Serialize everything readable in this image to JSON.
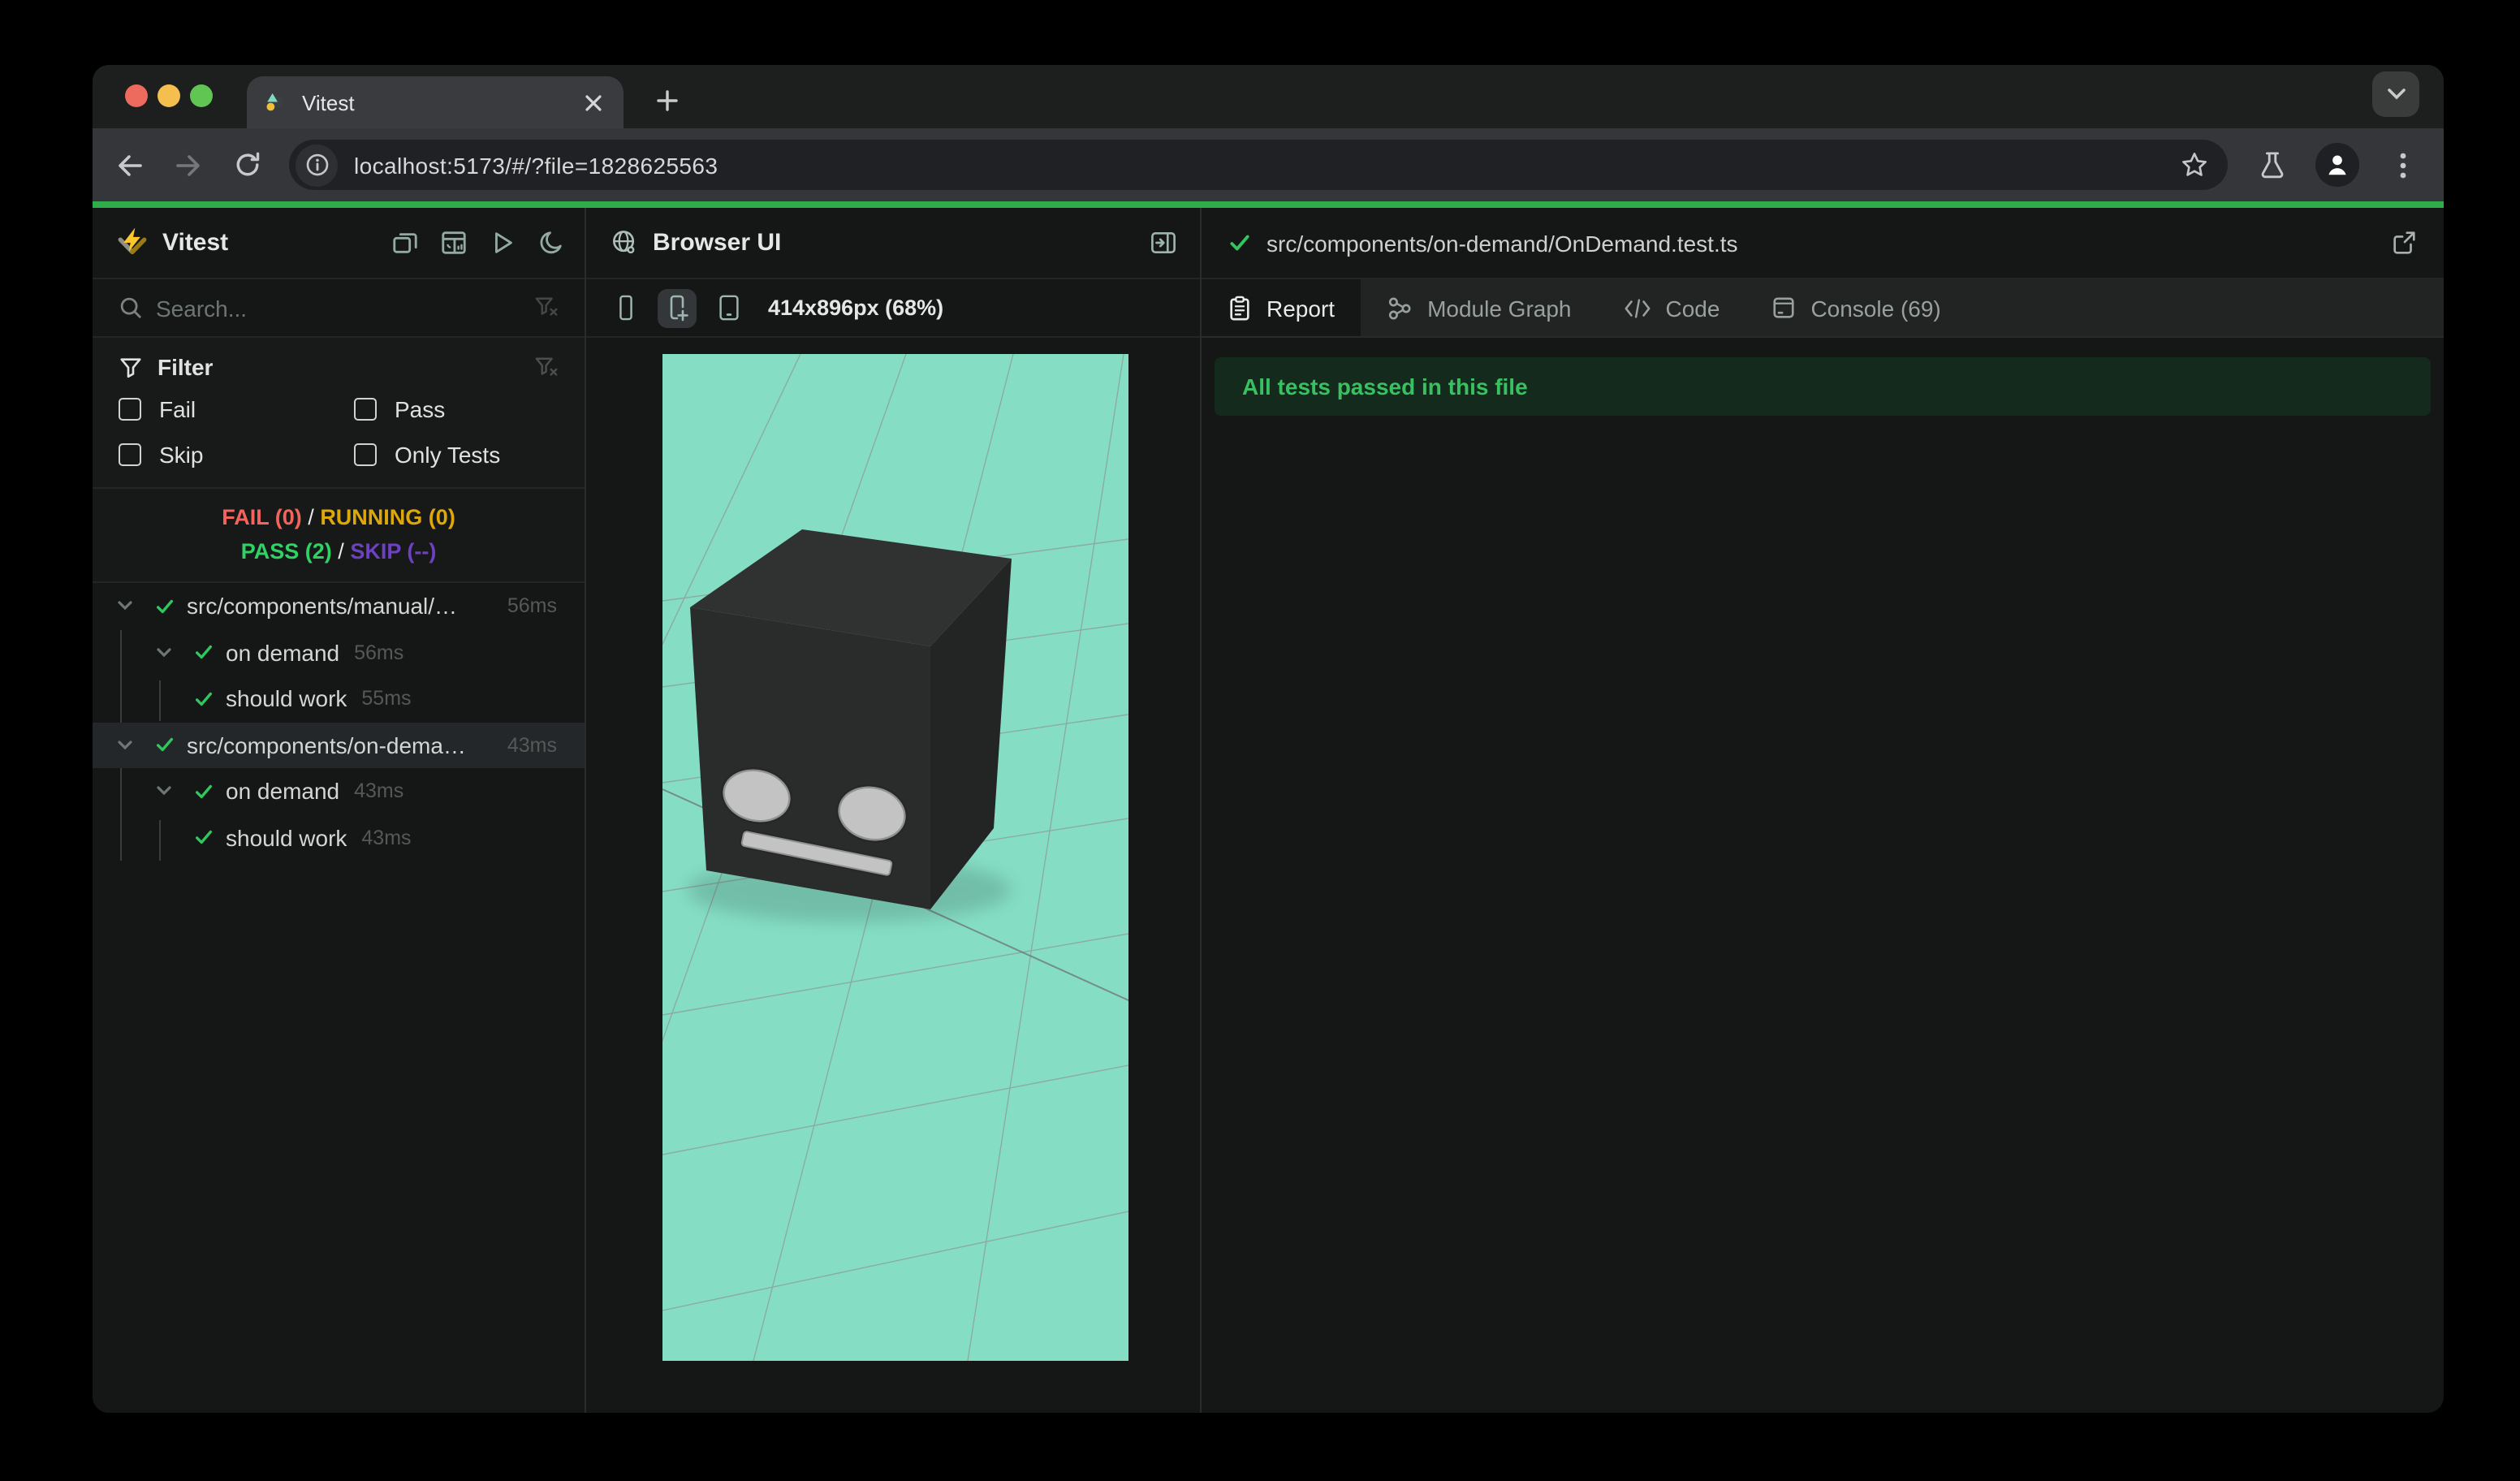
{
  "browser": {
    "tab_title": "Vitest",
    "url": "localhost:5173/#/?file=1828625563",
    "traffic_lights": {
      "red": "#ed6a5e",
      "yellow": "#f4bf4f",
      "green": "#61c554"
    }
  },
  "sidebar": {
    "app_title": "Vitest",
    "header_icons": [
      "collapse-windows-icon",
      "dashboard-icon",
      "run-all-icon",
      "dark-mode-icon"
    ],
    "search_placeholder": "Search...",
    "filter": {
      "title": "Filter",
      "options": [
        {
          "label": "Fail",
          "checked": false
        },
        {
          "label": "Pass",
          "checked": false
        },
        {
          "label": "Skip",
          "checked": false
        },
        {
          "label": "Only Tests",
          "checked": false
        }
      ]
    },
    "status": {
      "fail": "FAIL (0)",
      "running": "RUNNING (0)",
      "pass": "PASS (2)",
      "skip": "SKIP (--)",
      "separator": "/",
      "colors": {
        "fail": "#f3645d",
        "running": "#dca80b",
        "pass": "#2fd264",
        "skip": "#6e40c2"
      }
    },
    "tree": [
      {
        "label": "src/components/manual/…",
        "duration": "56ms",
        "depth": 0,
        "state": "pass",
        "selected": false
      },
      {
        "label": "on demand",
        "duration": "56ms",
        "depth": 1,
        "state": "pass",
        "selected": false
      },
      {
        "label": "should work",
        "duration": "55ms",
        "depth": 2,
        "state": "pass",
        "selected": false
      },
      {
        "label": "src/components/on-dema…",
        "duration": "43ms",
        "depth": 0,
        "state": "pass",
        "selected": true
      },
      {
        "label": "on demand",
        "duration": "43ms",
        "depth": 1,
        "state": "pass",
        "selected": false
      },
      {
        "label": "should work",
        "duration": "43ms",
        "depth": 2,
        "state": "pass",
        "selected": false
      }
    ]
  },
  "browser_panel": {
    "title": "Browser UI",
    "viewport_label": "414x896px (68%)",
    "device_icons": [
      "phone-narrow-icon",
      "phone-plus-icon",
      "phone-wide-icon"
    ],
    "scene": {
      "subject": "robot-head-cube-3d-preview",
      "background": "#85dec4",
      "cube_top": "#303231",
      "cube_front": "#2a2c2b",
      "cube_right": "#232525",
      "face_features": "#c3c3c3",
      "grid_line": "#8f918f"
    }
  },
  "report_panel": {
    "file_path": "src/components/on-demand/OnDemand.test.ts",
    "tabs": [
      {
        "label": "Report",
        "active": true
      },
      {
        "label": "Module Graph",
        "active": false
      },
      {
        "label": "Code",
        "active": false
      },
      {
        "label": "Console (69)",
        "active": false
      }
    ],
    "banner": "All tests passed in this file",
    "banner_colors": {
      "bg": "#142a1c",
      "text": "#38c161"
    }
  },
  "theme": {
    "progress_bar": "#2ead4a",
    "page_bg": "#151716",
    "chrome_toolbar": "#35363a"
  }
}
